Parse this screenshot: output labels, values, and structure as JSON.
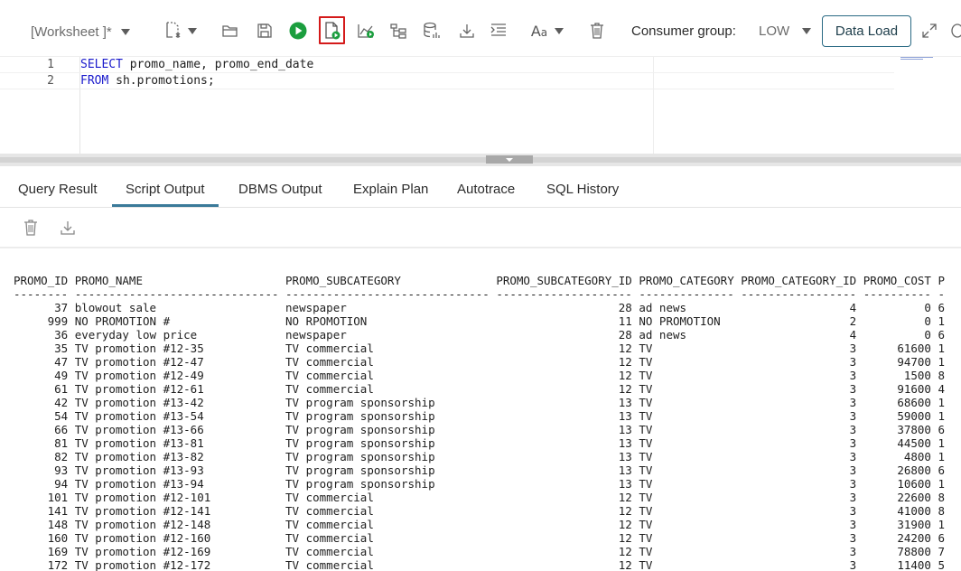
{
  "toolbar": {
    "worksheet_name": "[Worksheet ]*",
    "consumer_group_label": "Consumer group:",
    "consumer_group_value": "LOW",
    "data_load_label": "Data Load",
    "icons": [
      "new-worksheet-icon",
      "open-icon",
      "save-icon",
      "run-statement-icon",
      "run-script-icon",
      "explain-plan-icon",
      "autotrace-icon",
      "sql-history-icon",
      "download-icon",
      "format-icon",
      "text-case-icon",
      "clear-icon",
      "expand-icon"
    ]
  },
  "editor": {
    "lines": [
      {
        "number": "1",
        "keyword": "SELECT",
        "rest": " promo_name, promo_end_date"
      },
      {
        "number": "2",
        "keyword": "FROM",
        "rest": " sh.promotions;"
      }
    ]
  },
  "tabs": [
    "Query Result",
    "Script Output",
    "DBMS Output",
    "Explain Plan",
    "Autotrace",
    "SQL History"
  ],
  "active_tab": "Script Output",
  "output": {
    "lines": [
      "PROMO_ID PROMO_NAME                     PROMO_SUBCATEGORY              PROMO_SUBCATEGORY_ID PROMO_CATEGORY PROMO_CATEGORY_ID PROMO_COST P",
      "-------- ------------------------------ ------------------------------ -------------------- -------------- ----------------- ---------- -",
      "      37 blowout sale                   newspaper                                        28 ad news                        4          0 6",
      "     999 NO PROMOTION #                 NO RPOMOTION                                     11 NO PROMOTION                   2          0 1",
      "      36 everyday low price             newspaper                                        28 ad news                        4          0 6",
      "      35 TV promotion #12-35            TV commercial                                    12 TV                             3      61600 1",
      "      47 TV promotion #12-47            TV commercial                                    12 TV                             3      94700 1",
      "      49 TV promotion #12-49            TV commercial                                    12 TV                             3       1500 8",
      "      61 TV promotion #12-61            TV commercial                                    12 TV                             3      91600 4",
      "      42 TV promotion #13-42            TV program sponsorship                           13 TV                             3      68600 1",
      "      54 TV promotion #13-54            TV program sponsorship                           13 TV                             3      59000 1",
      "      66 TV promotion #13-66            TV program sponsorship                           13 TV                             3      37800 6",
      "      81 TV promotion #13-81            TV program sponsorship                           13 TV                             3      44500 1",
      "      82 TV promotion #13-82            TV program sponsorship                           13 TV                             3       4800 1",
      "      93 TV promotion #13-93            TV program sponsorship                           13 TV                             3      26800 6",
      "      94 TV promotion #13-94            TV program sponsorship                           13 TV                             3      10600 1",
      "     101 TV promotion #12-101           TV commercial                                    12 TV                             3      22600 8",
      "     141 TV promotion #12-141           TV commercial                                    12 TV                             3      41000 8",
      "     148 TV promotion #12-148           TV commercial                                    12 TV                             3      31900 1",
      "     160 TV promotion #12-160           TV commercial                                    12 TV                             3      24200 6",
      "     169 TV promotion #12-169           TV commercial                                    12 TV                             3      78800 7",
      "     172 TV promotion #12-172           TV commercial                                    12 TV                             3      11400 5"
    ]
  },
  "colors": {
    "accent": "#3a7a99",
    "run_green": "#1b9e3e",
    "highlight_red": "#d41a1a",
    "sql_keyword": "#1a1acc"
  }
}
